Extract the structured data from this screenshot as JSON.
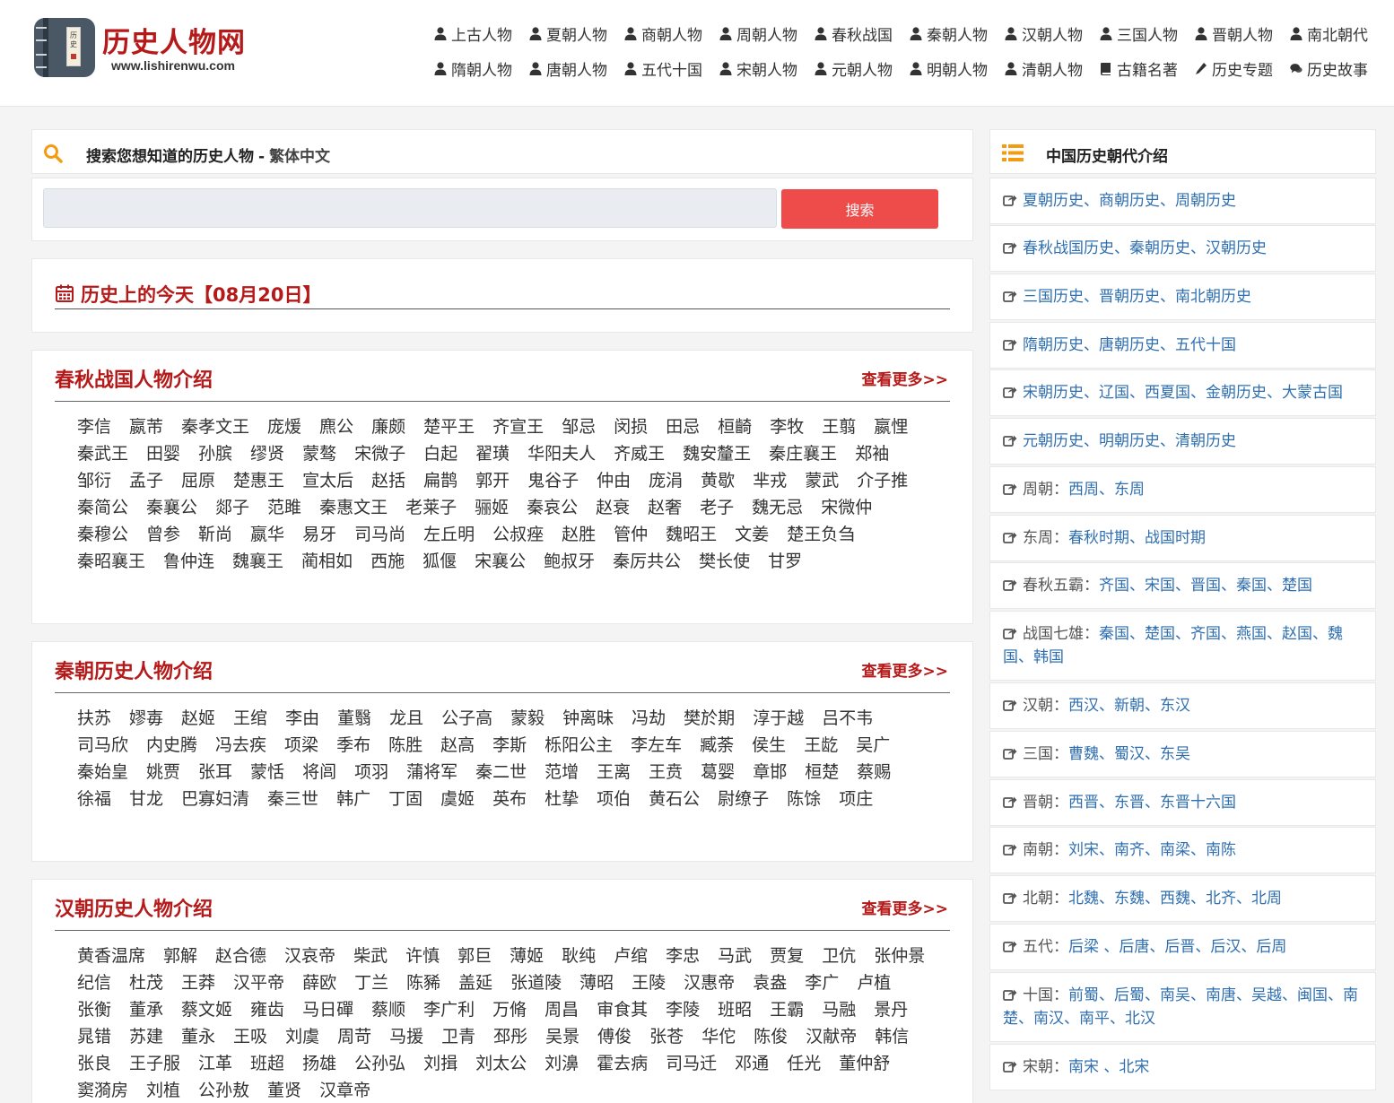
{
  "site": {
    "title": "历史人物网",
    "url": "www.lishirenwu.com",
    "book_label": "历史"
  },
  "nav": {
    "row1": [
      "上古人物",
      "夏朝人物",
      "商朝人物",
      "周朝人物",
      "春秋战国",
      "秦朝人物",
      "汉朝人物",
      "三国人物",
      "晋朝人物",
      "南北朝代"
    ],
    "row2": [
      {
        "label": "隋朝人物",
        "icon": "user-icon"
      },
      {
        "label": "唐朝人物",
        "icon": "user-icon"
      },
      {
        "label": "五代十国",
        "icon": "user-icon"
      },
      {
        "label": "宋朝人物",
        "icon": "user-icon"
      },
      {
        "label": "元朝人物",
        "icon": "user-icon"
      },
      {
        "label": "明朝人物",
        "icon": "user-icon"
      },
      {
        "label": "清朝人物",
        "icon": "user-icon"
      },
      {
        "label": "古籍名著",
        "icon": "book-icon"
      },
      {
        "label": "历史专题",
        "icon": "pencil-icon"
      },
      {
        "label": "历史故事",
        "icon": "comments-icon"
      }
    ]
  },
  "search": {
    "title": "搜索您想知道的历史人物",
    "separator": "-",
    "traditional_link": "繁体中文",
    "input_value": "",
    "button_label": "搜索"
  },
  "today": {
    "label": "历史上的今天【08月20日】"
  },
  "sections": [
    {
      "title": "春秋战国人物介绍",
      "more": "查看更多>>",
      "names": [
        "李信",
        "嬴芾",
        "秦孝文王",
        "庞煖",
        "麃公",
        "廉颇",
        "楚平王",
        "齐宣王",
        "邹忌",
        "闵损",
        "田忌",
        "桓齮",
        "李牧",
        "王翦",
        "嬴悝",
        "秦武王",
        "田婴",
        "孙膑",
        "缪贤",
        "蒙骜",
        "宋微子",
        "白起",
        "翟璜",
        "华阳夫人",
        "齐威王",
        "魏安釐王",
        "秦庄襄王",
        "郑袖",
        "邹衍",
        "孟子",
        "屈原",
        "楚惠王",
        "宣太后",
        "赵括",
        "扁鹊",
        "郭开",
        "鬼谷子",
        "仲由",
        "庞涓",
        "黄歇",
        "芈戎",
        "蒙武",
        "介子推",
        "秦简公",
        "秦襄公",
        "郯子",
        "范雎",
        "秦惠文王",
        "老莱子",
        "骊姬",
        "秦哀公",
        "赵衰",
        "赵奢",
        "老子",
        "魏无忌",
        "宋微仲",
        "秦穆公",
        "曾参",
        "靳尚",
        "嬴华",
        "易牙",
        "司马尚",
        "左丘明",
        "公叔痤",
        "赵胜",
        "管仲",
        "魏昭王",
        "文姜",
        "楚王负刍",
        "秦昭襄王",
        "鲁仲连",
        "魏襄王",
        "蔺相如",
        "西施",
        "狐偃",
        "宋襄公",
        "鲍叔牙",
        "秦厉共公",
        "樊长使",
        "甘罗"
      ]
    },
    {
      "title": "秦朝历史人物介绍",
      "more": "查看更多>>",
      "names": [
        "扶苏",
        "嫪毐",
        "赵姬",
        "王绾",
        "李由",
        "董翳",
        "龙且",
        "公子高",
        "蒙毅",
        "钟离昧",
        "冯劫",
        "樊於期",
        "淳于越",
        "吕不韦",
        "司马欣",
        "内史腾",
        "冯去疾",
        "项梁",
        "季布",
        "陈胜",
        "赵高",
        "李斯",
        "栎阳公主",
        "李左车",
        "臧荼",
        "侯生",
        "王龁",
        "吴广",
        "秦始皇",
        "姚贾",
        "张耳",
        "蒙恬",
        "将闾",
        "项羽",
        "蒲将军",
        "秦二世",
        "范增",
        "王离",
        "王贲",
        "葛婴",
        "章邯",
        "桓楚",
        "蔡赐",
        "徐福",
        "甘龙",
        "巴寡妇清",
        "秦三世",
        "韩广",
        "丁固",
        "虞姬",
        "英布",
        "杜挚",
        "项伯",
        "黄石公",
        "尉缭子",
        "陈馀",
        "项庄"
      ]
    },
    {
      "title": "汉朝历史人物介绍",
      "more": "查看更多>>",
      "names": [
        "黄香温席",
        "郭解",
        "赵合德",
        "汉哀帝",
        "柴武",
        "许慎",
        "郭巨",
        "薄姬",
        "耿纯",
        "卢绾",
        "李忠",
        "马武",
        "贾复",
        "卫伉",
        "张仲景",
        "纪信",
        "杜茂",
        "王莽",
        "汉平帝",
        "薛欧",
        "丁兰",
        "陈豨",
        "盖延",
        "张道陵",
        "薄昭",
        "王陵",
        "汉惠帝",
        "袁盎",
        "李广",
        "卢植",
        "张衡",
        "董承",
        "蔡文姬",
        "雍齿",
        "马日磾",
        "蔡顺",
        "李广利",
        "万脩",
        "周昌",
        "审食其",
        "李陵",
        "班昭",
        "王霸",
        "马融",
        "景丹",
        "晁错",
        "苏建",
        "董永",
        "王吸",
        "刘虞",
        "周苛",
        "马援",
        "卫青",
        "邳彤",
        "吴景",
        "傅俊",
        "张苍",
        "华佗",
        "陈俊",
        "汉献帝",
        "韩信",
        "张良",
        "王子服",
        "江革",
        "班超",
        "扬雄",
        "公孙弘",
        "刘揖",
        "刘太公",
        "刘濞",
        "霍去病",
        "司马迁",
        "邓通",
        "任光",
        "董仲舒",
        "窦漪房",
        "刘植",
        "公孙敖",
        "董贤",
        "汉章帝"
      ]
    }
  ],
  "sidebar": {
    "title": "中国历史朝代介绍",
    "items": [
      {
        "label": "",
        "links": "夏朝历史、商朝历史、周朝历史"
      },
      {
        "label": "",
        "links": "春秋战国历史、秦朝历史、汉朝历史"
      },
      {
        "label": "",
        "links": "三国历史、晋朝历史、南北朝历史"
      },
      {
        "label": "",
        "links": "隋朝历史、唐朝历史、五代十国"
      },
      {
        "label": "",
        "links": "宋朝历史、辽国、西夏国、金朝历史、大蒙古国"
      },
      {
        "label": "",
        "links": "元朝历史、明朝历史、清朝历史"
      },
      {
        "label": "周朝：",
        "links": "西周、东周"
      },
      {
        "label": "东周：",
        "links": "春秋时期、战国时期"
      },
      {
        "label": "春秋五霸：",
        "links": "齐国、宋国、晋国、秦国、楚国"
      },
      {
        "label": "战国七雄：",
        "links": "秦国、楚国、齐国、燕国、赵国、魏国、韩国"
      },
      {
        "label": "汉朝：",
        "links": "西汉、新朝、东汉"
      },
      {
        "label": "三国：",
        "links": "曹魏、蜀汉、东吴"
      },
      {
        "label": "晋朝：",
        "links": "西晋、东晋、东晋十六国"
      },
      {
        "label": "南朝：",
        "links": "刘宋、南齐、南梁、南陈"
      },
      {
        "label": "北朝：",
        "links": "北魏、东魏、西魏、北齐、北周"
      },
      {
        "label": "五代：",
        "links": "后梁 、后唐、后晋、后汉、后周"
      },
      {
        "label": "十国：",
        "links": "前蜀、后蜀、南吴、南唐、吴越、闽国、南楚、南汉、南平、北汉"
      },
      {
        "label": "宋朝：",
        "links": "南宋 、北宋"
      }
    ]
  },
  "colors": {
    "accent_red": "#b51a1a",
    "search_button": "#ee4b4b",
    "icon_orange": "#f39c12",
    "link_blue": "#2f6fb0"
  }
}
